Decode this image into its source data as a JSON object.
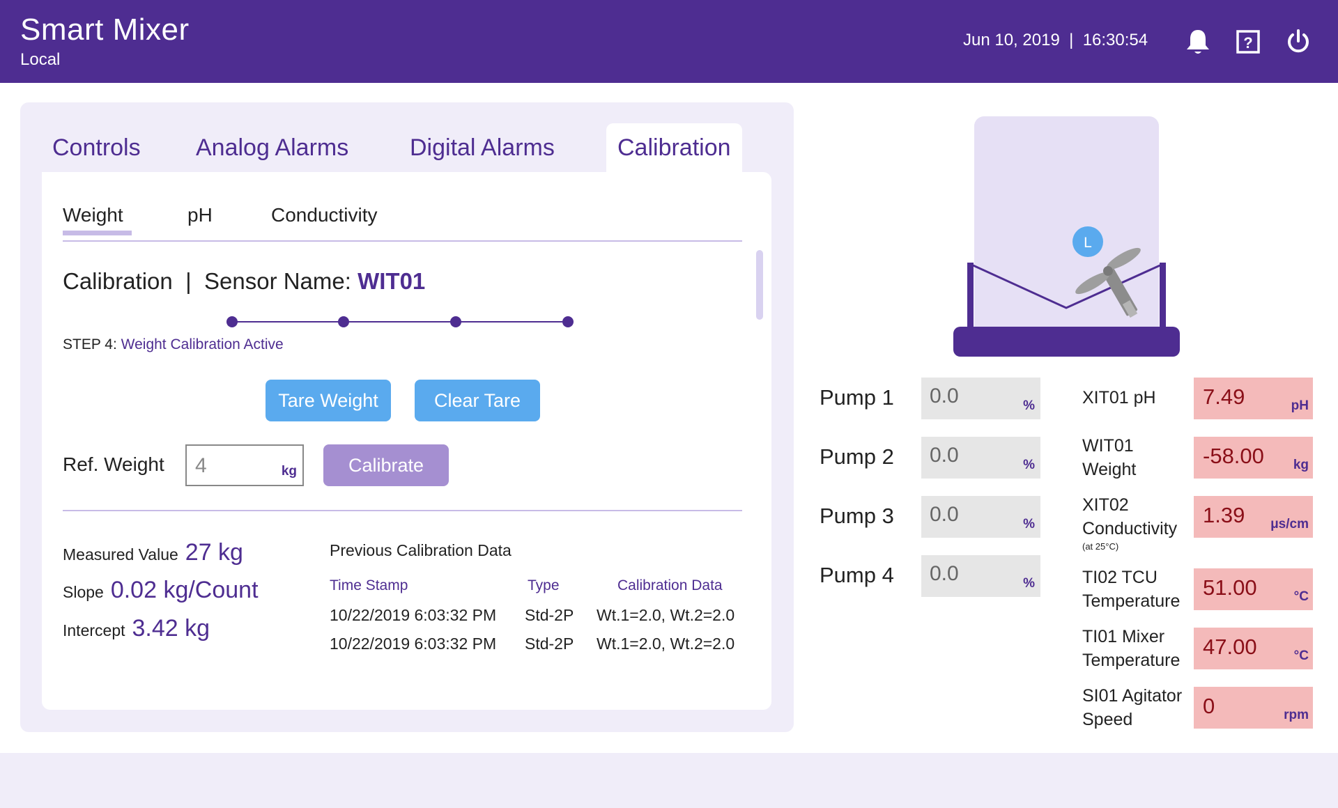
{
  "header": {
    "title": "Smart Mixer",
    "subtitle": "Local",
    "datetime": "Jun 10, 2019  |  16:30:54",
    "icons": [
      "bell-icon",
      "help-icon",
      "power-icon"
    ]
  },
  "tabs": [
    "Controls",
    "Analog Alarms",
    "Digital Alarms",
    "Calibration"
  ],
  "active_tab": "Calibration",
  "subtabs": [
    "Weight",
    "pH",
    "Conductivity"
  ],
  "active_subtab": "Weight",
  "calibration": {
    "title_prefix": "Calibration  |  Sensor Name: ",
    "sensor_name": "WIT01",
    "step_prefix": "STEP 4: ",
    "step_text": "Weight Calibration Active",
    "step_count": 4,
    "current_step": 4,
    "tare_button": "Tare Weight",
    "clear_tare_button": "Clear Tare",
    "ref_weight_label": "Ref. Weight",
    "ref_weight_value": "4",
    "ref_weight_unit": "kg",
    "calibrate_button": "Calibrate",
    "measured_label": "Measured Value",
    "measured_value": "27 kg",
    "slope_label": "Slope",
    "slope_value": "0.02 kg/Count",
    "intercept_label": "Intercept",
    "intercept_value": "3.42 kg"
  },
  "previous": {
    "title": "Previous Calibration Data",
    "headers": [
      "Time Stamp",
      "Type",
      "Calibration Data"
    ],
    "rows": [
      [
        "10/22/2019 6:03:32 PM",
        "Std-2P",
        "Wt.1=2.0, Wt.2=2.0"
      ],
      [
        "10/22/2019 6:03:32 PM",
        "Std-2P",
        "Wt.1=2.0, Wt.2=2.0"
      ]
    ]
  },
  "vessel": {
    "level_indicator": "L"
  },
  "pumps": [
    {
      "label": "Pump 1",
      "value": "0.0",
      "unit": "%"
    },
    {
      "label": "Pump 2",
      "value": "0.0",
      "unit": "%"
    },
    {
      "label": "Pump 3",
      "value": "0.0",
      "unit": "%"
    },
    {
      "label": "Pump 4",
      "value": "0.0",
      "unit": "%"
    }
  ],
  "sensors": [
    {
      "line1": "XIT01 pH",
      "line2": "",
      "note": "",
      "value": "7.49",
      "unit": "pH"
    },
    {
      "line1": "WIT01",
      "line2": "Weight",
      "note": "",
      "value": "-58.00",
      "unit": "kg"
    },
    {
      "line1": "XIT02",
      "line2": "Conductivity",
      "note": "(at 25°C)",
      "value": "1.39",
      "unit": "μs/cm"
    },
    {
      "line1": "TI02 TCU",
      "line2": "Temperature",
      "note": "",
      "value": "51.00",
      "unit": "°C"
    },
    {
      "line1": "TI01 Mixer",
      "line2": "Temperature",
      "note": "",
      "value": "47.00",
      "unit": "°C"
    },
    {
      "line1": "SI01 Agitator",
      "line2": "Speed",
      "note": "",
      "value": "0",
      "unit": "rpm"
    }
  ],
  "colors": {
    "brand": "#4e2d91",
    "panel_bg": "#f0edf9",
    "button_blue": "#5aaaee",
    "button_disabled": "#a58fd1",
    "alarm_bg": "#f4baba",
    "alarm_text": "#8a0f18"
  }
}
